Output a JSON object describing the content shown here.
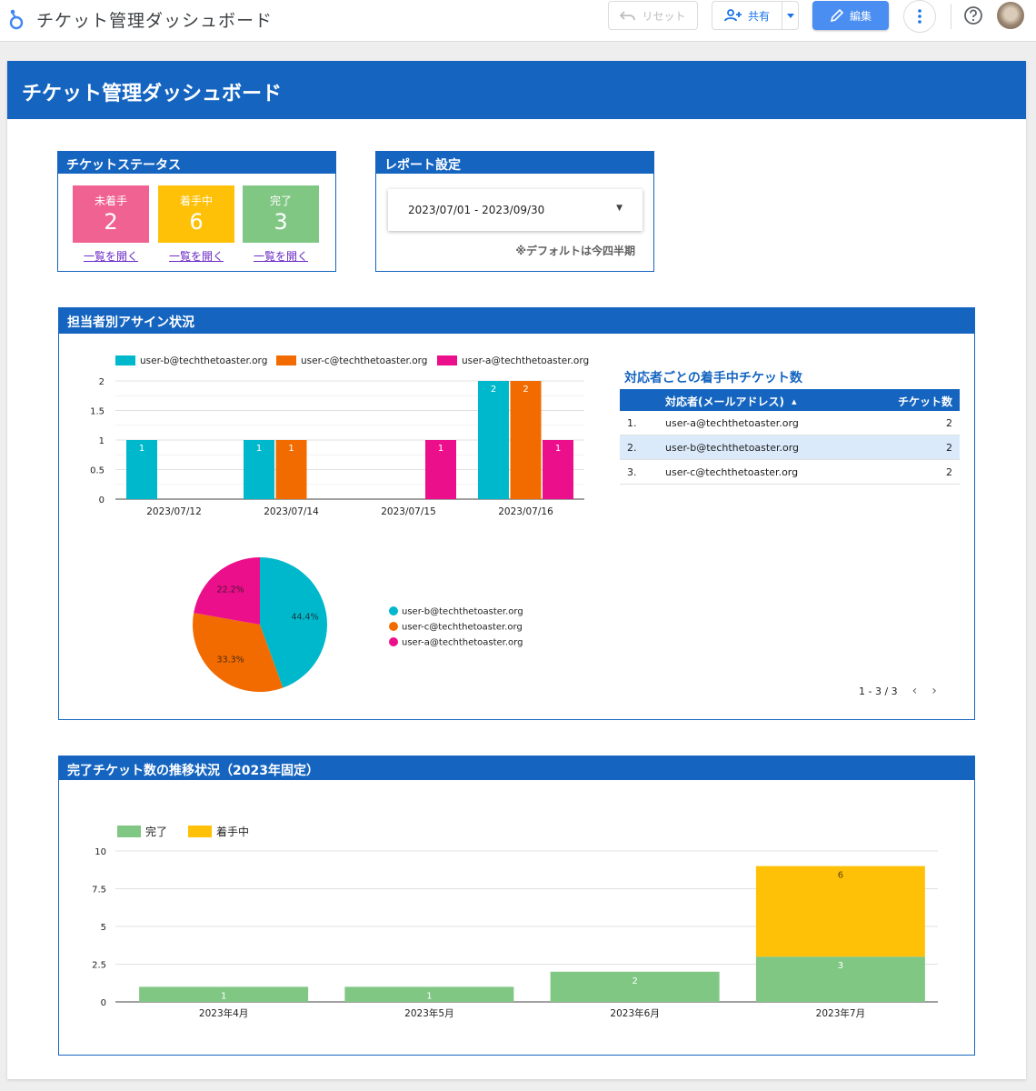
{
  "app": {
    "title": "チケット管理ダッシュボード",
    "reset_label": "リセット",
    "share_label": "共有",
    "edit_label": "編集"
  },
  "report": {
    "title": "チケット管理ダッシュボード"
  },
  "status_card": {
    "title": "チケットステータス",
    "tiles": [
      {
        "label": "未着手",
        "value": "2",
        "link": "一覧を開く",
        "color": "#f06292"
      },
      {
        "label": "着手中",
        "value": "6",
        "link": "一覧を開く",
        "color": "#ffc107"
      },
      {
        "label": "完了",
        "value": "3",
        "link": "一覧を開く",
        "color": "#81c784"
      }
    ]
  },
  "settings_card": {
    "title": "レポート設定",
    "date_range": "2023/07/01 - 2023/09/30",
    "note": "※デフォルトは今四半期"
  },
  "assign_card": {
    "title": "担当者別アサイン状況",
    "table": {
      "title": "対応者ごとの着手中チケット数",
      "col_email": "対応者(メールアドレス)",
      "sort_icon": "▲",
      "col_count": "チケット数",
      "rows": [
        {
          "idx": "1.",
          "email": "user-a@techthetoaster.org",
          "count": "2"
        },
        {
          "idx": "2.",
          "email": "user-b@techthetoaster.org",
          "count": "2"
        },
        {
          "idx": "3.",
          "email": "user-c@techthetoaster.org",
          "count": "2"
        }
      ],
      "pager": "1 - 3 / 3"
    }
  },
  "completion_card": {
    "title": "完了チケット数の推移状況（2023年固定）"
  },
  "colors": {
    "accent": "#1565c0",
    "user_b": "#00b8cc",
    "user_c": "#f26b00",
    "user_a": "#ec0f8c",
    "done": "#81c784",
    "in_progress": "#ffc107"
  },
  "chart_data": [
    {
      "type": "bar",
      "categories": [
        "2023/07/12",
        "2023/07/14",
        "2023/07/15",
        "2023/07/16"
      ],
      "series": [
        {
          "name": "user-b@techthetoaster.org",
          "values": [
            1,
            1,
            0,
            2
          ],
          "color": "#00b8cc"
        },
        {
          "name": "user-c@techthetoaster.org",
          "values": [
            0,
            1,
            0,
            2
          ],
          "color": "#f26b00"
        },
        {
          "name": "user-a@techthetoaster.org",
          "values": [
            0,
            0,
            1,
            1
          ],
          "color": "#ec0f8c"
        }
      ],
      "yticks": [
        "0",
        "0.5",
        "1",
        "1.5",
        "2"
      ],
      "ylim": [
        0,
        2
      ],
      "grid": true,
      "legend": "top",
      "data_labels": true
    },
    {
      "type": "pie",
      "slices": [
        {
          "name": "user-b@techthetoaster.org",
          "value": 44.4,
          "label": "44.4%",
          "color": "#00b8cc"
        },
        {
          "name": "user-c@techthetoaster.org",
          "value": 33.3,
          "label": "33.3%",
          "color": "#f26b00"
        },
        {
          "name": "user-a@techthetoaster.org",
          "value": 22.2,
          "label": "22.2%",
          "color": "#ec0f8c"
        }
      ],
      "legend": "right"
    },
    {
      "type": "bar",
      "stacked": true,
      "categories": [
        "2023年4月",
        "2023年5月",
        "2023年6月",
        "2023年7月"
      ],
      "series": [
        {
          "name": "完了",
          "values": [
            1,
            1,
            2,
            3
          ],
          "color": "#81c784"
        },
        {
          "name": "着手中",
          "values": [
            0,
            0,
            0,
            6
          ],
          "color": "#ffc107"
        }
      ],
      "yticks": [
        "0",
        "2.5",
        "5",
        "7.5",
        "10"
      ],
      "ylim": [
        0,
        10
      ],
      "grid": true,
      "legend": "top-left",
      "data_labels": true
    }
  ]
}
